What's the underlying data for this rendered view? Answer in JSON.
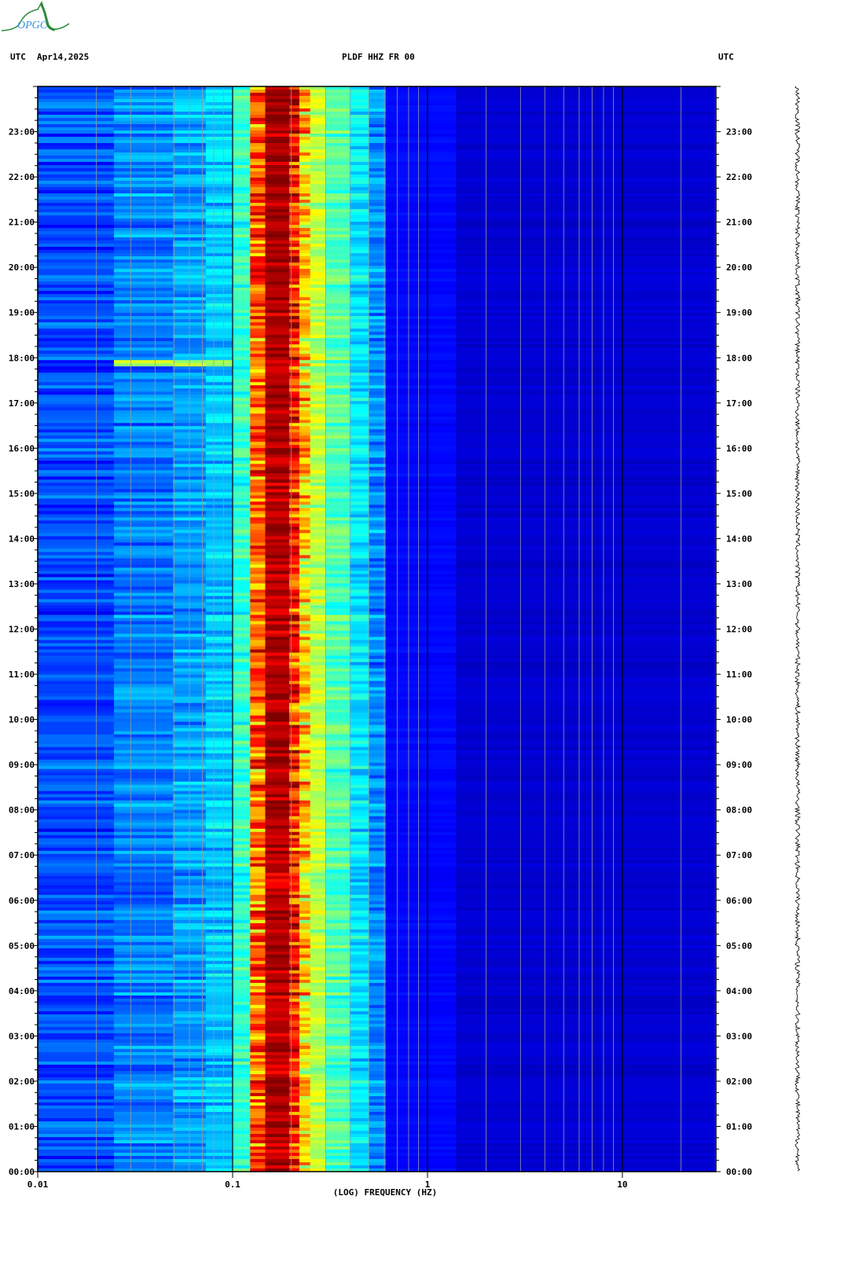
{
  "logo": {
    "text": "OPGC"
  },
  "header": {
    "left_tz": "UTC",
    "date": "Apr14,2025",
    "station": "PLDF HHZ FR 00",
    "right_tz": "UTC"
  },
  "colors": {
    "grid_minor": "#9a9a9a",
    "grid_major": "#000000",
    "axis": "#000000"
  },
  "chart_data": {
    "type": "heatmap",
    "title": "PLDF HHZ FR 00",
    "xlabel": "(LOG) FREQUENCY (HZ)",
    "ylabel": "UTC",
    "xscale": "log",
    "xlim": [
      0.01,
      30
    ],
    "ylim_hours": [
      0,
      24
    ],
    "x_ticks": [
      {
        "value": 0.01,
        "label": "0.01"
      },
      {
        "value": 0.1,
        "label": "0.1"
      },
      {
        "value": 1,
        "label": "1"
      },
      {
        "value": 10,
        "label": "10"
      }
    ],
    "y_ticks": [
      "00:00",
      "01:00",
      "02:00",
      "03:00",
      "04:00",
      "05:00",
      "06:00",
      "07:00",
      "08:00",
      "09:00",
      "10:00",
      "11:00",
      "12:00",
      "13:00",
      "14:00",
      "15:00",
      "16:00",
      "17:00",
      "18:00",
      "19:00",
      "20:00",
      "21:00",
      "22:00",
      "23:00"
    ],
    "colormap": "jet",
    "band_edges_hz": [
      0.01,
      0.0246,
      0.0494,
      0.0729,
      0.1,
      0.123,
      0.147,
      0.195,
      0.22,
      0.25,
      0.3,
      0.4,
      0.5,
      0.61,
      1.4,
      30
    ],
    "band_levels": [
      0.2,
      0.25,
      0.28,
      0.32,
      0.42,
      0.76,
      0.95,
      0.84,
      0.66,
      0.56,
      0.45,
      0.35,
      0.26,
      0.13,
      0.08
    ],
    "events": [
      {
        "hour": 17.92,
        "freq_range_hz": [
          0.0246,
          0.1
        ],
        "level": 0.5
      }
    ],
    "grid": true
  }
}
